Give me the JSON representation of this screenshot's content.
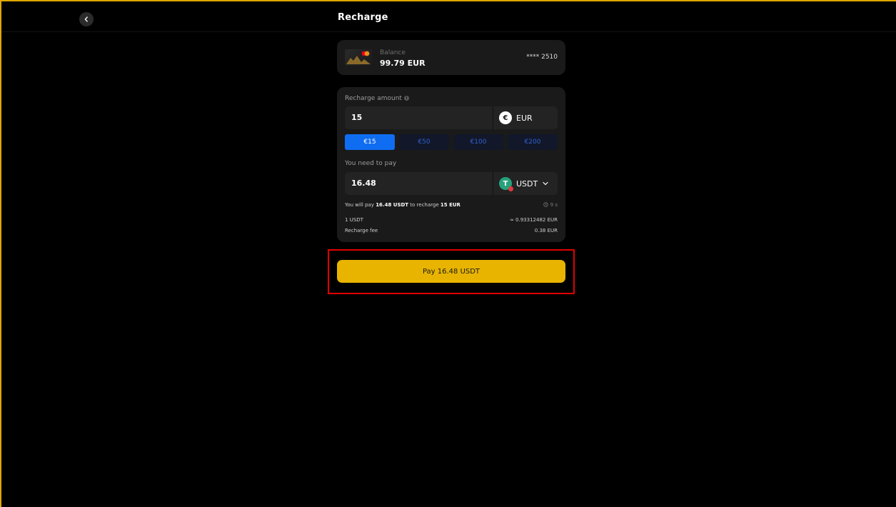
{
  "header": {
    "title": "Recharge"
  },
  "balance": {
    "label": "Balance",
    "value": "99.79 EUR",
    "card_number": "**** 2510"
  },
  "recharge": {
    "amount_label": "Recharge amount",
    "amount_value": "15",
    "amount_currency": "EUR",
    "presets": [
      "€15",
      "€50",
      "€100",
      "€200"
    ],
    "selected_preset": "€15",
    "pay_label": "You need to pay",
    "pay_value": "16.48",
    "pay_currency": "USDT",
    "summary_prefix": "You will pay ",
    "summary_amount": "16.48 USDT",
    "summary_middle": " to recharge ",
    "summary_target": "15 EUR",
    "timer": "9 s",
    "rate_left": "1 USDT",
    "rate_right": "≈ 0.93312482 EUR",
    "fee_label": "Recharge fee",
    "fee_value": "0.38 EUR"
  },
  "action": {
    "pay_button": "Pay 16.48 USDT"
  },
  "colors": {
    "accent": "#e8b400",
    "chip_active": "#0f6df2",
    "highlight": "#e00000"
  }
}
